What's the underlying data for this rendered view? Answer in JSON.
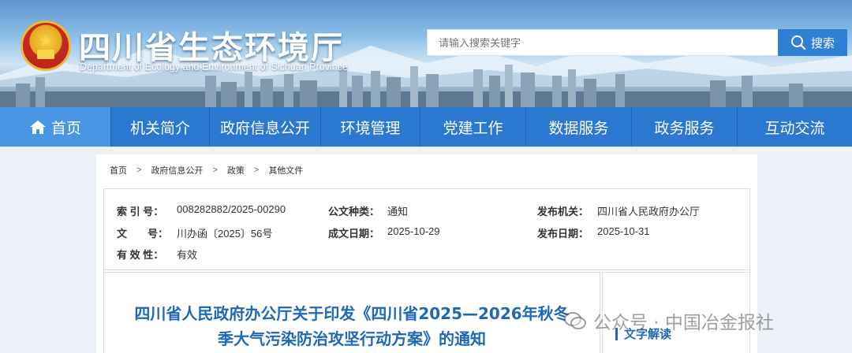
{
  "header": {
    "site_title": "四川省生态环境厅",
    "site_subtitle": "Department of Ecology and Environment of Sichuan Province",
    "search_placeholder": "请输入搜索关键字",
    "search_button": "搜索"
  },
  "nav": {
    "items": [
      {
        "label": "首页",
        "active": true
      },
      {
        "label": "机关简介"
      },
      {
        "label": "政府信息公开"
      },
      {
        "label": "环境管理"
      },
      {
        "label": "党建工作"
      },
      {
        "label": "数据服务"
      },
      {
        "label": "政务服务"
      },
      {
        "label": "互动交流"
      }
    ]
  },
  "breadcrumb": {
    "items": [
      "首页",
      "政府信息公开",
      "政策",
      "其他文件"
    ],
    "separator": ">"
  },
  "info": {
    "index_label": "索 引 号：",
    "index_value": "008282882/2025-00290",
    "category_label": "公文种类：",
    "category_value": "通知",
    "issuer_label": "发布机关：",
    "issuer_value": "四川省人民政府办公厅",
    "docno_label": "文　　号：",
    "docno_value": "川办函〔2025〕56号",
    "created_label": "成文日期：",
    "created_value": "2025-10-29",
    "published_label": "发布日期：",
    "published_value": "2025-10-31",
    "validity_label": "有 效 性：",
    "validity_value": "有效"
  },
  "document": {
    "title_line1": "四川省人民政府办公厅关于印发《四川省2025—2026年秋冬",
    "title_line2": "季大气污染防治攻坚行动方案》的通知"
  },
  "side": {
    "label": "文字解读"
  },
  "watermark": {
    "text": "公众号 · 中国冶金报社"
  },
  "colors": {
    "nav_bg": "#2a78cf",
    "nav_active": "#4a95e4",
    "title_blue": "#1f67b7"
  }
}
